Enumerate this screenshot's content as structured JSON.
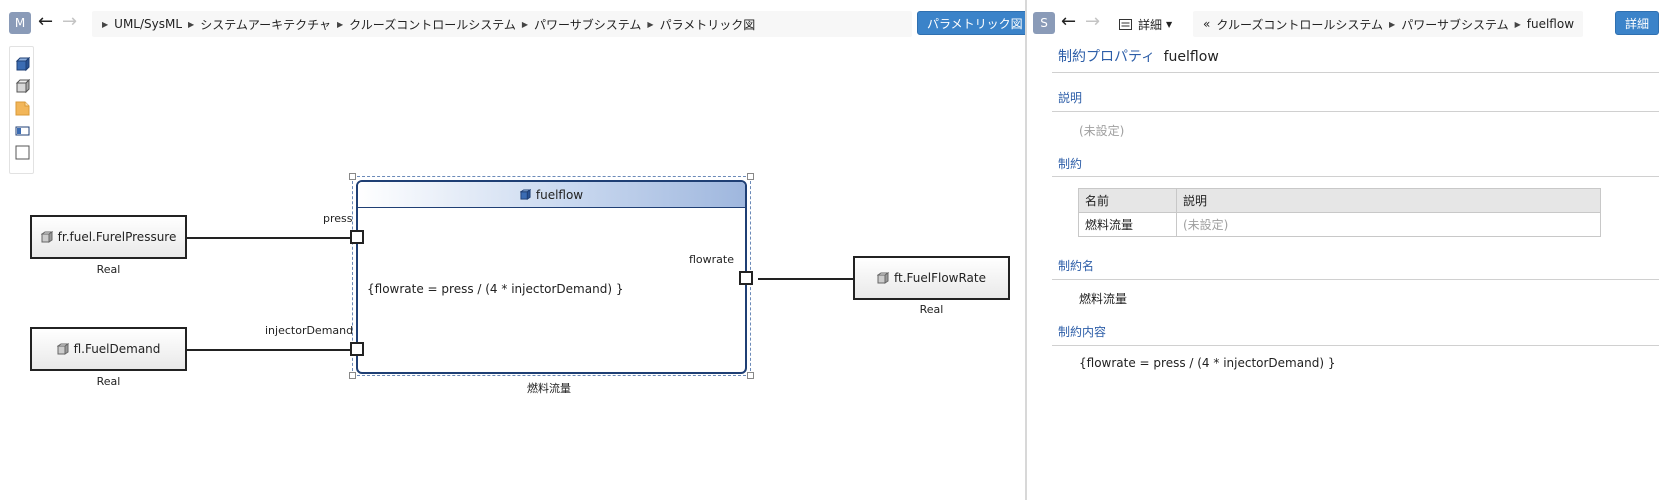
{
  "left": {
    "app_badge": "M",
    "breadcrumb": [
      "UML/SysML",
      "システムアーキテクチャ",
      "クルーズコントロールシステム",
      "パワーサブシステム",
      "パラメトリック図"
    ],
    "primary_button": "パラメトリック図",
    "palette": [
      "constraint-block-icon",
      "block-icon",
      "note-icon",
      "part-icon",
      "rectangle-icon"
    ]
  },
  "diagram": {
    "blocks": [
      {
        "name": "fr.fuel.FurelPressure",
        "type": "Real"
      },
      {
        "name": "fl.FuelDemand",
        "type": "Real"
      },
      {
        "name": "ft.FuelFlowRate",
        "type": "Real"
      }
    ],
    "constraint": {
      "title": "fuelflow",
      "expression": "{flowrate = press / (4 * injectorDemand) }",
      "name": "燃料流量",
      "ports": [
        "press",
        "injectorDemand",
        "flowrate"
      ]
    }
  },
  "right": {
    "app_badge": "S",
    "detail_dropdown": "詳細",
    "breadcrumb": [
      "クルーズコントロールシステム",
      "パワーサブシステム",
      "fuelflow"
    ],
    "breadcrumb_prefix": "«",
    "primary_button": "詳細",
    "header_kind": "制約プロパティ",
    "header_name": "fuelflow",
    "sections": {
      "description": {
        "title": "説明",
        "value": "(未設定)"
      },
      "constraints": {
        "title": "制約",
        "columns": [
          "名前",
          "説明"
        ],
        "rows": [
          [
            "燃料流量",
            "(未設定)"
          ]
        ]
      },
      "constraint_name": {
        "title": "制約名",
        "value": "燃料流量"
      },
      "constraint_body": {
        "title": "制約内容",
        "value": "{flowrate = press / (4 * injectorDemand) }"
      }
    }
  },
  "colors": {
    "accent": "#3b83c9",
    "section_title": "#2d5ea8",
    "constraint_border": "#1f3f74"
  }
}
